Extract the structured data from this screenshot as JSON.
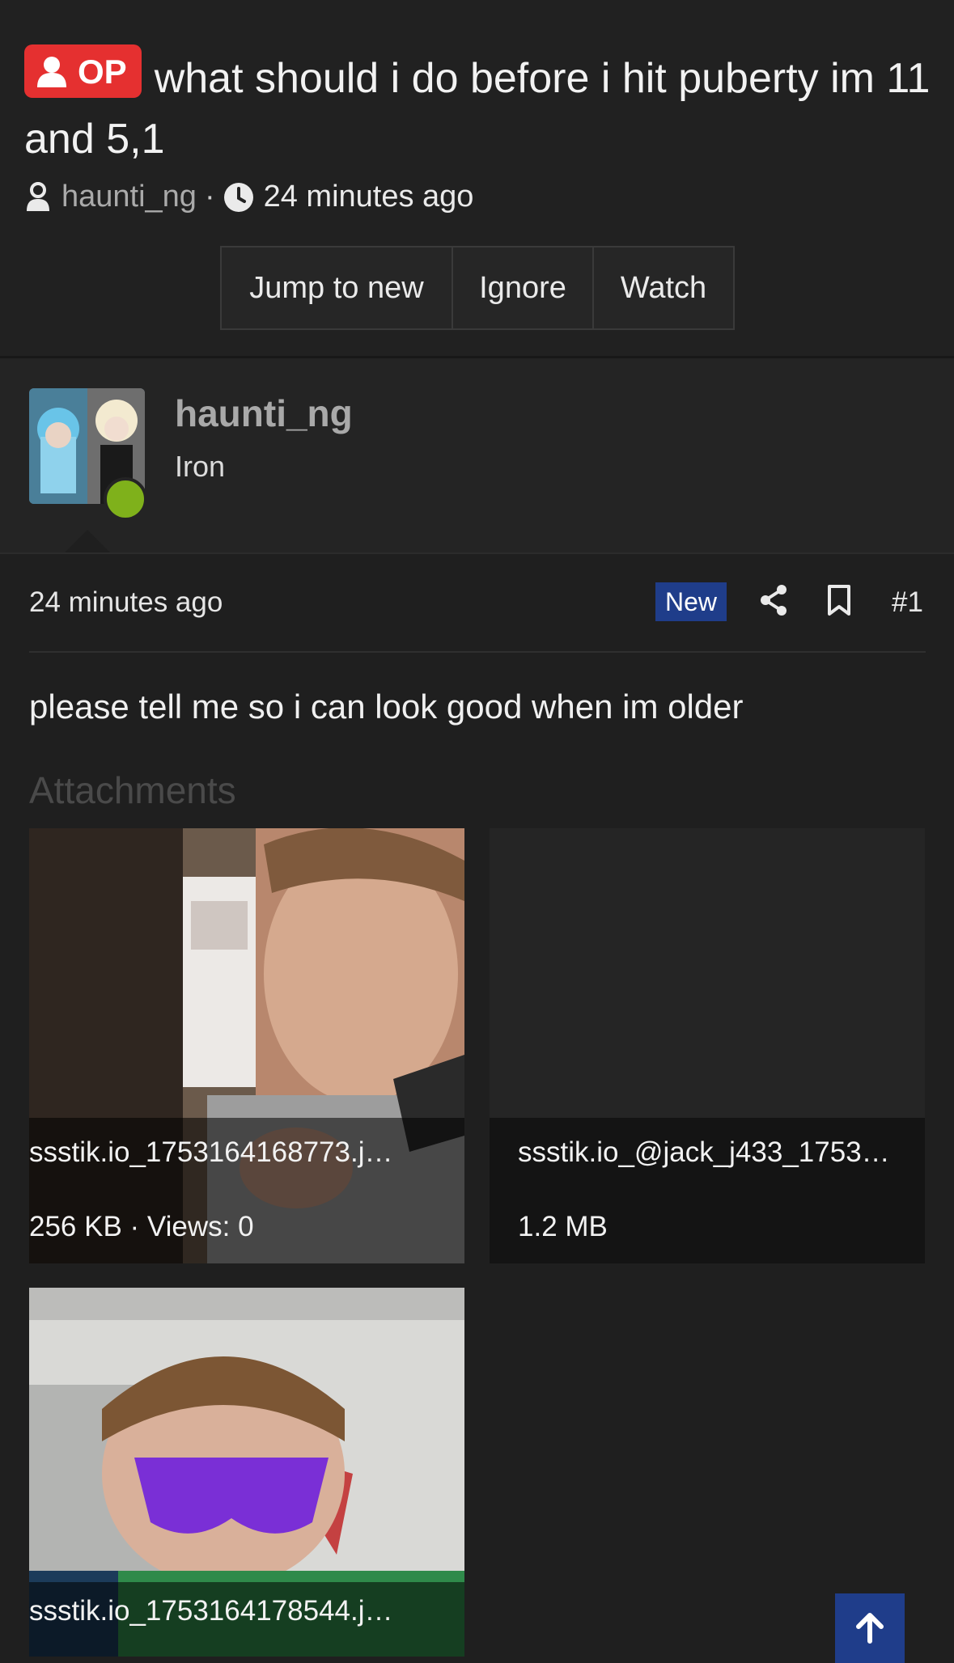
{
  "thread": {
    "op_label": "OP",
    "title": "what should i do before i hit puberty im 11 and 5,1",
    "author": "haunti_ng",
    "separator": "·",
    "time": "24 minutes ago"
  },
  "actions": {
    "jump": "Jump to new",
    "ignore": "Ignore",
    "watch": "Watch"
  },
  "user": {
    "name": "haunti_ng",
    "rank": "Iron"
  },
  "post": {
    "time": "24 minutes ago",
    "new_label": "New",
    "number": "#1",
    "body": "please tell me so i can look good when im older"
  },
  "attachments": {
    "heading": "Attachments",
    "items": [
      {
        "name": "ssstik.io_1753164168773.j…",
        "meta": "256 KB · Views: 0"
      },
      {
        "name": "ssstik.io_@jack_j433_1753…",
        "meta": "1.2 MB"
      },
      {
        "name": "ssstik.io_1753164178544.j…",
        "meta": ""
      }
    ]
  },
  "icons": {
    "accent": "#1f3d8a",
    "op_color": "#e53030",
    "online": "#7fb11b"
  }
}
